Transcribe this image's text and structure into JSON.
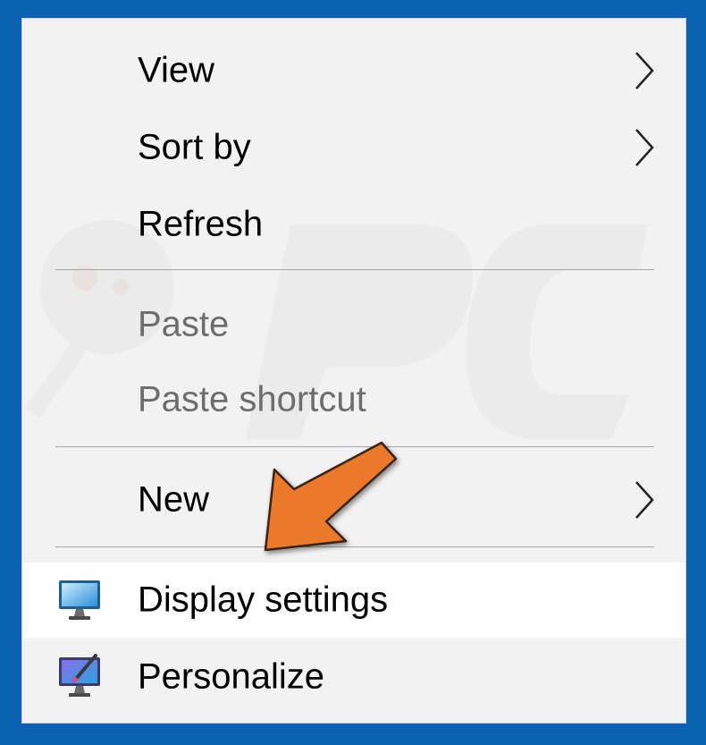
{
  "menu": {
    "items": [
      {
        "label": "View",
        "has_submenu": true,
        "enabled": true
      },
      {
        "label": "Sort by",
        "has_submenu": true,
        "enabled": true
      },
      {
        "label": "Refresh",
        "has_submenu": false,
        "enabled": true
      },
      {
        "label": "Paste",
        "has_submenu": false,
        "enabled": false
      },
      {
        "label": "Paste shortcut",
        "has_submenu": false,
        "enabled": false
      },
      {
        "label": "New",
        "has_submenu": true,
        "enabled": true
      },
      {
        "label": "Display settings",
        "icon": "display-settings-icon",
        "highlighted": true,
        "enabled": true
      },
      {
        "label": "Personalize",
        "icon": "personalize-icon",
        "enabled": true
      }
    ]
  },
  "annotation": {
    "icon": "orange-pointer-arrow-icon",
    "color": "#e8732a"
  },
  "colors": {
    "background": "#0b62b3",
    "menu": "#f2f2f2",
    "highlight": "#ffffff",
    "disabled_text": "#6d6d6d"
  }
}
